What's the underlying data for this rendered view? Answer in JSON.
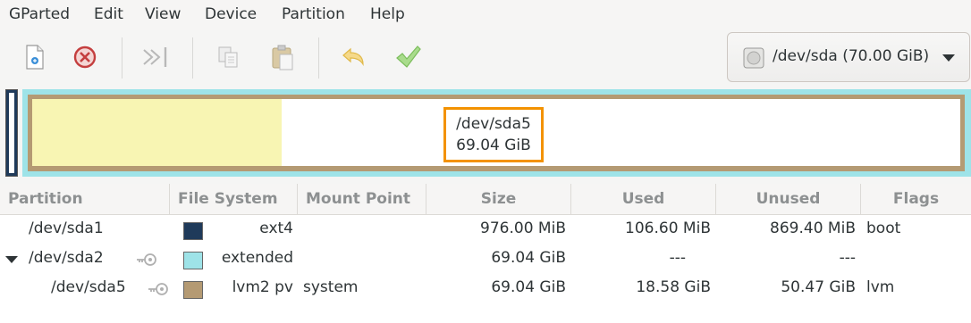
{
  "menubar": {
    "items": [
      "GParted",
      "Edit",
      "View",
      "Device",
      "Partition",
      "Help"
    ]
  },
  "toolbar": {
    "buttons": [
      "new-icon",
      "delete-icon",
      "resize-move-icon",
      "copy-icon",
      "paste-icon",
      "undo-icon",
      "apply-icon"
    ]
  },
  "device_selector": {
    "label": "/dev/sda (70.00 GiB)"
  },
  "disk_graphic": {
    "selected_partition": "/dev/sda5",
    "selected_size": "69.04 GiB",
    "colors": {
      "unallocated": "#1f3a5a",
      "extended": "#9ee3e8",
      "lvm2": "#b49a73",
      "used": "#f8f5b3",
      "highlight": "#f39200"
    }
  },
  "table": {
    "columns": [
      "Partition",
      "File System",
      "Mount Point",
      "Size",
      "Used",
      "Unused",
      "Flags"
    ],
    "rows": [
      {
        "partition": "/dev/sda1",
        "filesystem": "ext4",
        "fs_color": "#1f3a5a",
        "mount": "",
        "size": "976.00 MiB",
        "used": "106.60 MiB",
        "unused": "869.40 MiB",
        "flags": "boot"
      },
      {
        "partition": "/dev/sda2",
        "filesystem": "extended",
        "fs_color": "#9ee3e8",
        "mount": "",
        "size": "69.04 GiB",
        "used": "---",
        "unused": "---",
        "flags": ""
      },
      {
        "partition": "/dev/sda5",
        "filesystem": "lvm2 pv",
        "fs_color": "#b49a73",
        "mount": "system",
        "size": "69.04 GiB",
        "used": "18.58 GiB",
        "unused": "50.47 GiB",
        "flags": "lvm"
      }
    ]
  }
}
